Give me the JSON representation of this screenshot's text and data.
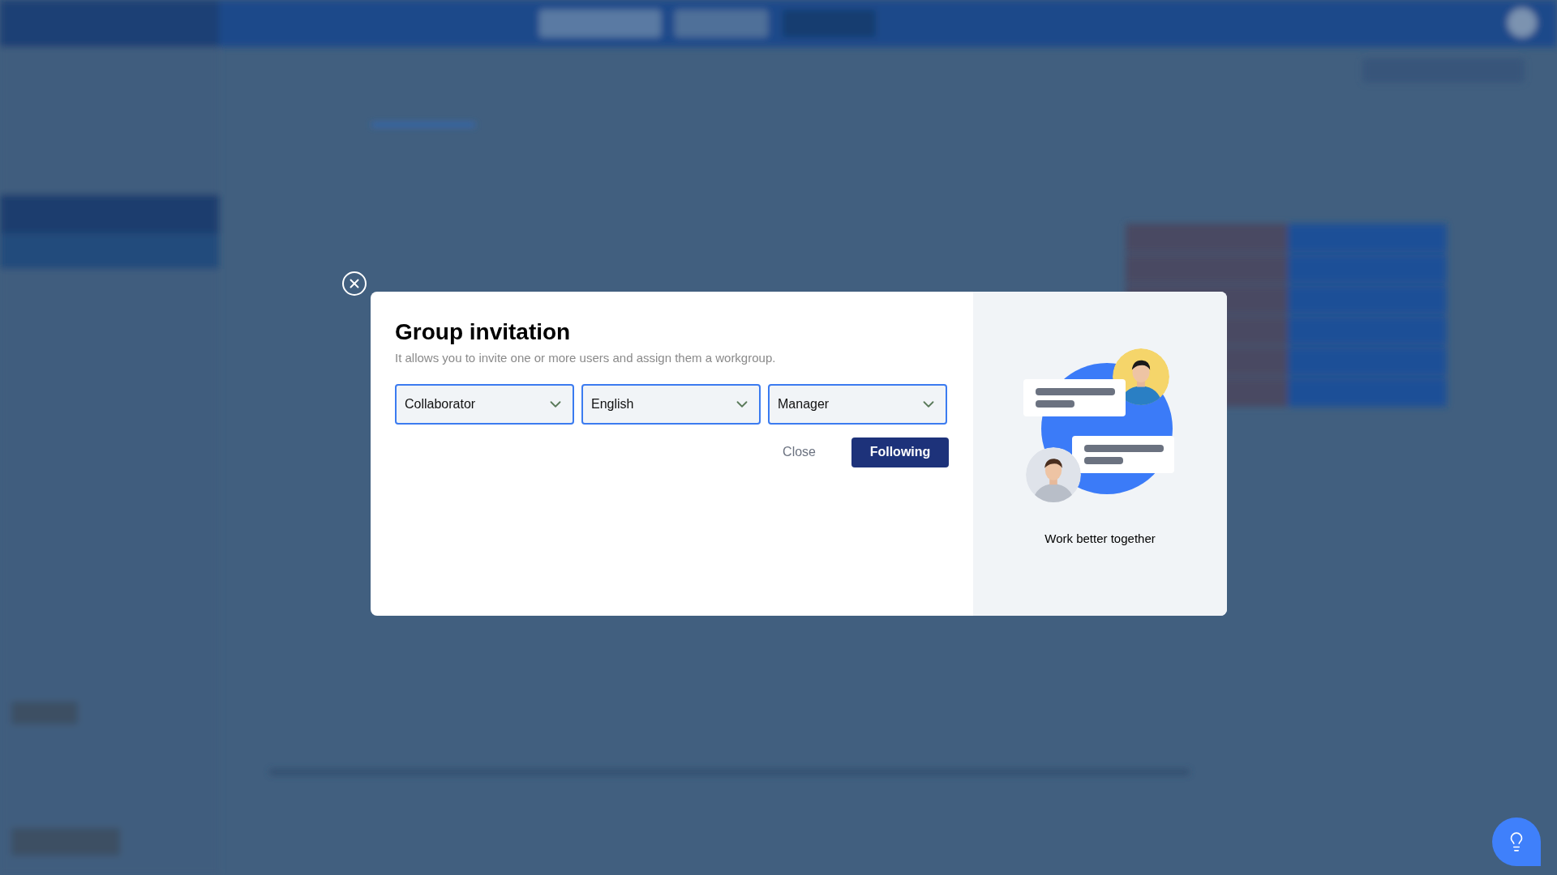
{
  "dialog": {
    "title": "Group invitation",
    "subtitle": "It allows you to invite one or more users and assign them a workgroup.",
    "selects": [
      {
        "value": "Collaborator"
      },
      {
        "value": "English"
      },
      {
        "value": "Manager"
      }
    ],
    "buttons": [
      {
        "kind": "text",
        "label": "Close"
      },
      {
        "kind": "primary",
        "label": "Following"
      }
    ],
    "illustration": {
      "caption": "Work better together"
    }
  }
}
